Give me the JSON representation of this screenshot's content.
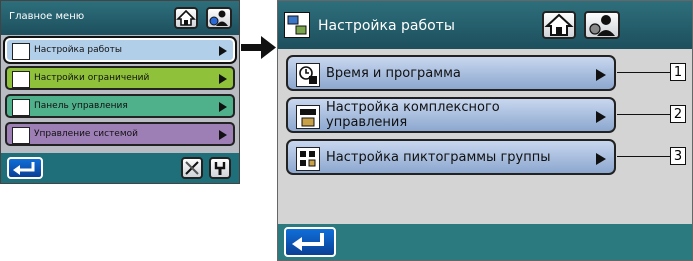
{
  "left_panel": {
    "title": "Главное меню",
    "items": [
      {
        "label": "Настройка работы",
        "color": "#b2cfe9",
        "icon": "settings-icon",
        "selected": true
      },
      {
        "label": "Настройки ограничений",
        "color": "#8fc23a",
        "icon": "restriction-icon",
        "selected": false
      },
      {
        "label": "Панель управления",
        "color": "#4fb08c",
        "icon": "panel-icon",
        "selected": false
      },
      {
        "label": "Управление системой",
        "color": "#9d7fb5",
        "icon": "system-icon",
        "selected": false
      }
    ]
  },
  "right_panel": {
    "title": "Настройка работы",
    "items": [
      {
        "line1": "Время и программа",
        "line2": "",
        "callout": "1",
        "icon": "clock-icon"
      },
      {
        "line1": "Настройка комплексного",
        "line2": "управления",
        "callout": "2",
        "icon": "complex-control-icon"
      },
      {
        "line1": "Настройка пиктограммы группы",
        "line2": "",
        "callout": "3",
        "icon": "group-icon"
      }
    ]
  }
}
